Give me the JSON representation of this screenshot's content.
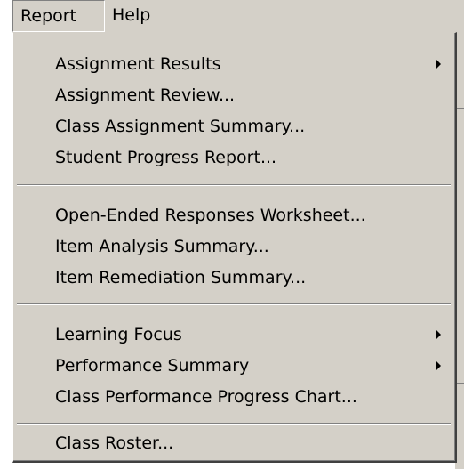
{
  "menubar": {
    "items": [
      {
        "label": "Report"
      },
      {
        "label": "Help"
      }
    ]
  },
  "report_menu": {
    "items": [
      {
        "label": "Assignment Results",
        "submenu": true
      },
      {
        "label": "Assignment Review...",
        "submenu": false
      },
      {
        "label": "Class Assignment Summary...",
        "submenu": false
      },
      {
        "label": "Student Progress Report...",
        "submenu": false
      },
      {
        "label": "Open-Ended Responses Worksheet...",
        "submenu": false
      },
      {
        "label": "Item Analysis Summary...",
        "submenu": false
      },
      {
        "label": "Item Remediation Summary...",
        "submenu": false
      },
      {
        "label": "Learning Focus",
        "submenu": true
      },
      {
        "label": "Performance Summary",
        "submenu": true
      },
      {
        "label": "Class Performance Progress Chart...",
        "submenu": false
      },
      {
        "label": "Class Roster...",
        "submenu": false
      }
    ]
  },
  "colors": {
    "menu_background": "#d4d0c8",
    "text": "#000000",
    "separator_dark": "#808080",
    "separator_light": "#ffffff"
  },
  "icons": {
    "submenu": "submenu-arrow-icon"
  }
}
